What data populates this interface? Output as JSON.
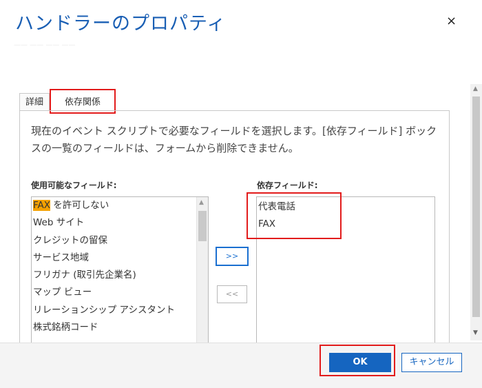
{
  "dialog": {
    "title": "ハンドラーのプロパティ",
    "close_glyph": "×",
    "faint_text": "—— —— —— ——"
  },
  "tabs": [
    {
      "label": "詳細"
    },
    {
      "label": "依存関係"
    }
  ],
  "description": "現在のイベント スクリプトで必要なフィールドを選択します。[依存フィールド] ボックスの一覧のフィールドは、フォームから削除できません。",
  "available": {
    "label": "使用可能なフィールド:",
    "items": [
      {
        "highlight": "FAX",
        "rest": " を許可しない"
      },
      {
        "text": "Web サイト"
      },
      {
        "text": "クレジットの留保"
      },
      {
        "text": "サービス地域"
      },
      {
        "text": "フリガナ (取引先企業名)"
      },
      {
        "text": "マップ ビュー"
      },
      {
        "text": "リレーションシップ アシスタント"
      },
      {
        "text": "株式銘柄コード"
      }
    ]
  },
  "dependent": {
    "label": "依存フィールド:",
    "items": [
      "代表電話",
      "FAX"
    ]
  },
  "buttons": {
    "add": ">>",
    "remove": "<<",
    "ok": "OK",
    "cancel": "キャンセル"
  },
  "icons": {
    "scroll_up": "▲",
    "scroll_down": "▼"
  }
}
